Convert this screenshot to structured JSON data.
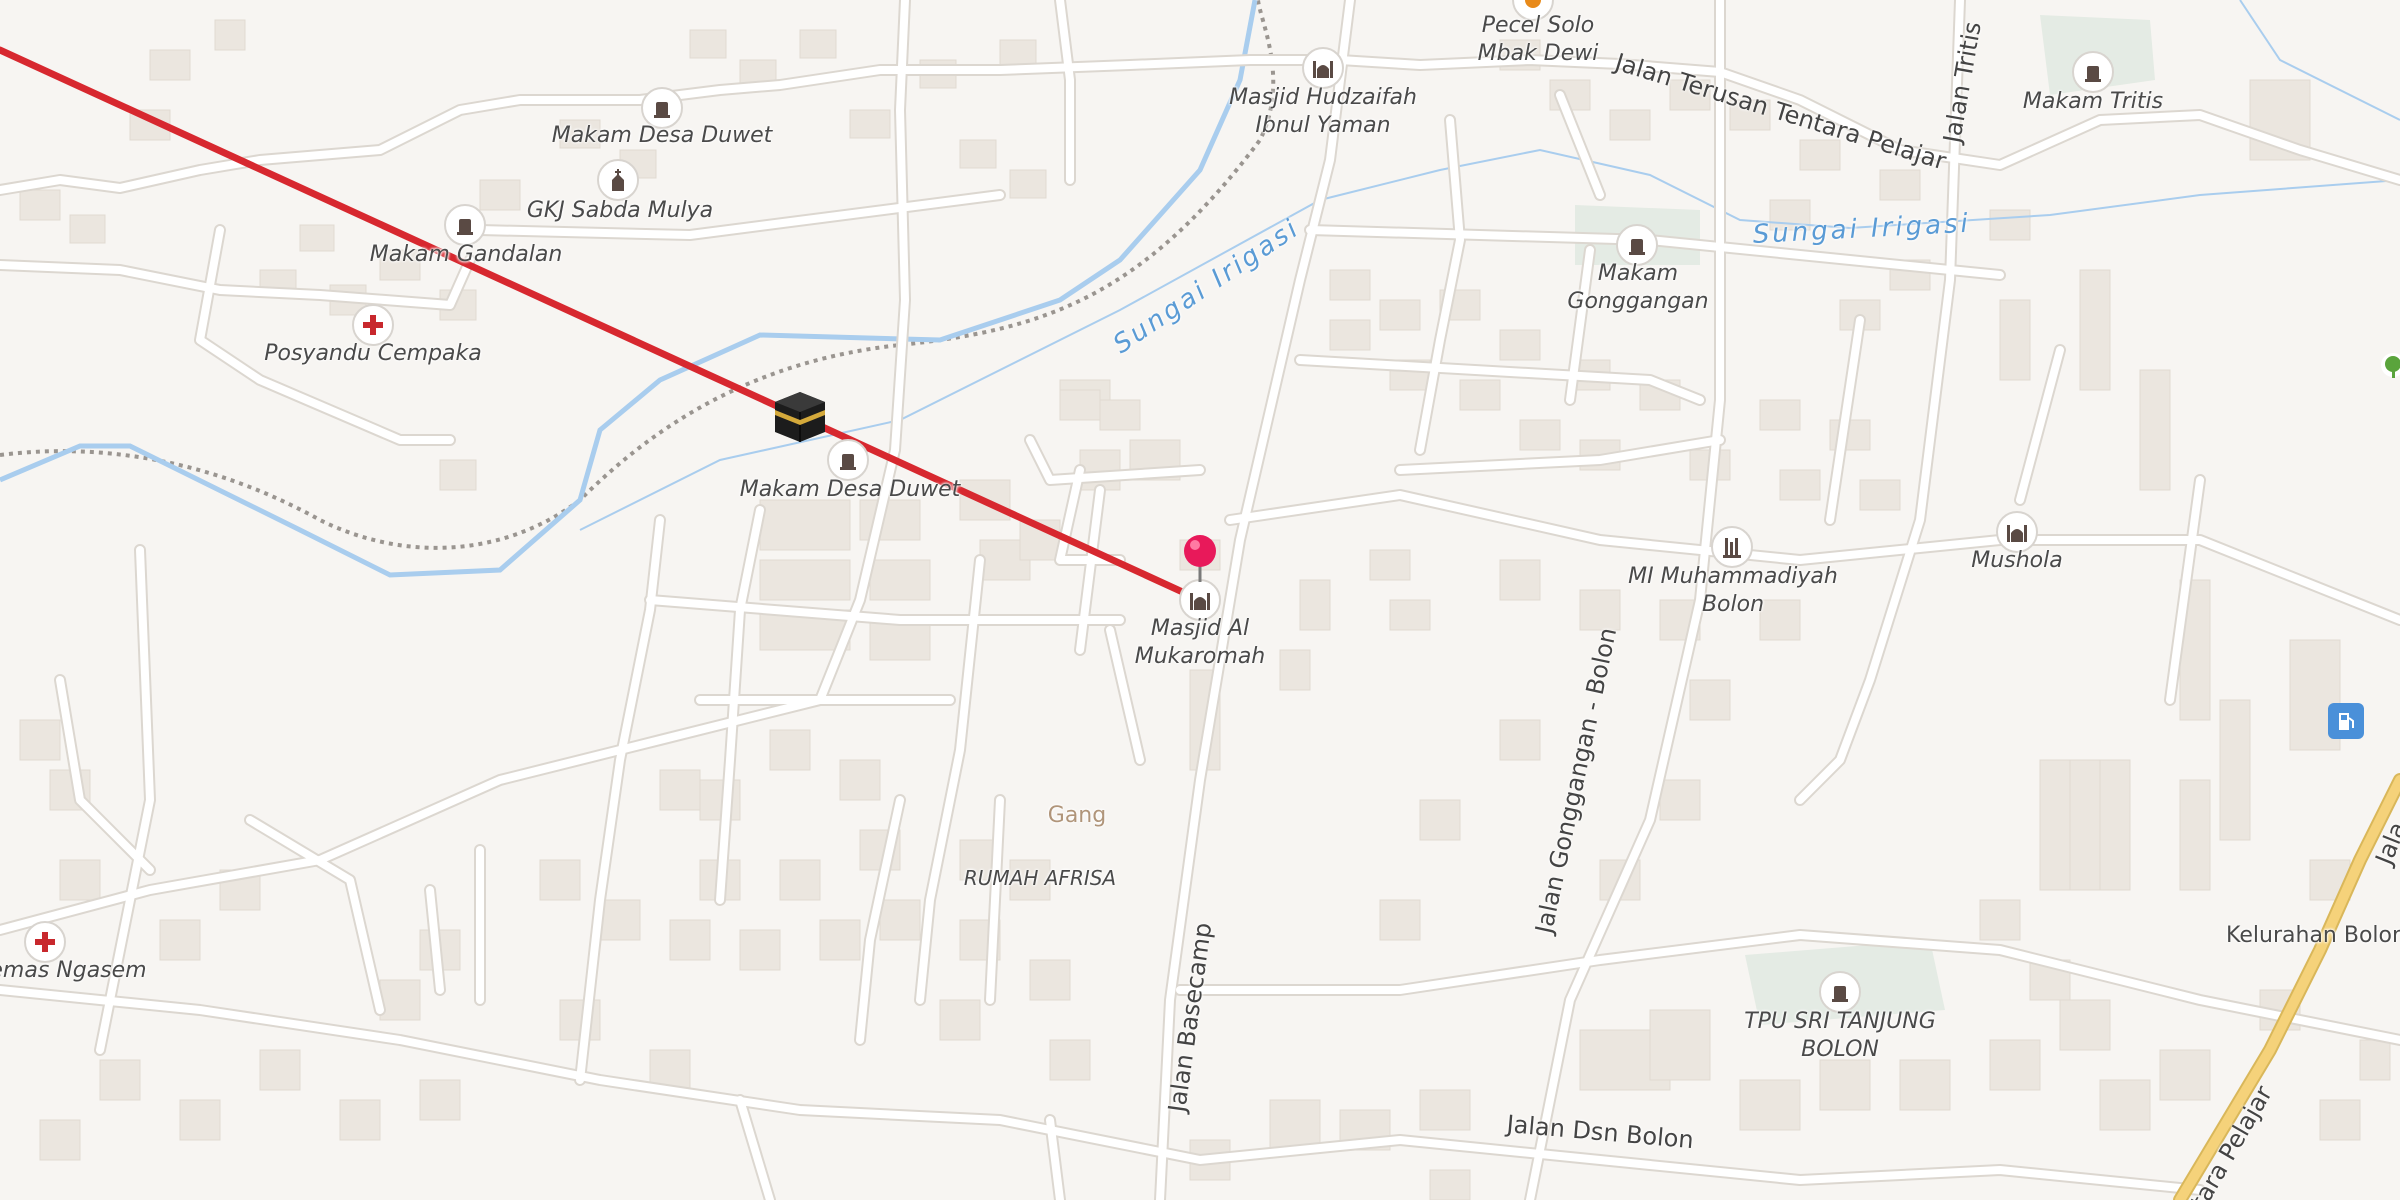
{
  "map": {
    "colors": {
      "background": "#f7f5f2",
      "building": "#ebe6df",
      "road": "#ffffff",
      "road_casing": "#dcd7d0",
      "water": "#a9cdee",
      "cemetery": "#e4ebe4",
      "primary_road": "#f5d27a",
      "route_line": "#d7282f",
      "pin": "#e8195a"
    },
    "route": {
      "description": "straight line from off-map to selected location"
    },
    "selected": {
      "name_line1": "Masjid Al",
      "name_line2": "Mukaromah",
      "icon": "mosque-icon"
    },
    "destination_icon": "kaaba-icon",
    "pois": {
      "makam_desa_duwet_top": "Makam Desa Duwet",
      "gkj_sabda_mulya": "GKJ Sabda Mulya",
      "makam_gandalan": "Makam Gandalan",
      "posyandu_cempaka": "Posyandu Cempaka",
      "makam_desa_duwet_mid": "Makam Desa Duwet",
      "pecel_line1": "Pecel Solo",
      "pecel_line2": "Mbak Dewi",
      "masjid_hudzaifah_line1": "Masjid Hudzaifah",
      "masjid_hudzaifah_line2": "Ibnul Yaman",
      "makam_tritis": "Makam Tritis",
      "makam_gonggangan_line1": "Makam",
      "makam_gonggangan_line2": "Gonggangan",
      "mi_muhammadiyah_line1": "MI Muhammadiyah",
      "mi_muhammadiyah_line2": "Bolon",
      "mushola": "Mushola",
      "gang": "Gang",
      "rumah_afrisa": "RUMAH AFRISA",
      "puskesmas": "emas Ngasem",
      "tpu_line1": "TPU SRI TANJUNG",
      "tpu_line2": "BOLON",
      "kelurahan_bolon": "Kelurahan Bolon"
    },
    "roads": {
      "jalan_terusan": "Jalan Terusan Tentara Pelajar",
      "jalan_tritis": "Jalan Tritis",
      "jalan_gonggangan": "Jalan Gonggangan - Bolon",
      "jalan_basecamp": "Jalan Basecamp",
      "jalan_dsn_bolon": "Jalan Dsn Bolon",
      "tentara_pelajar_bottom": "tara Pelajar",
      "jalan_right_edge": "Jala"
    },
    "water": {
      "sungai_irigasi_1": "Sungai Irigasi",
      "sungai_irigasi_2": "Sungai Irigasi"
    }
  }
}
